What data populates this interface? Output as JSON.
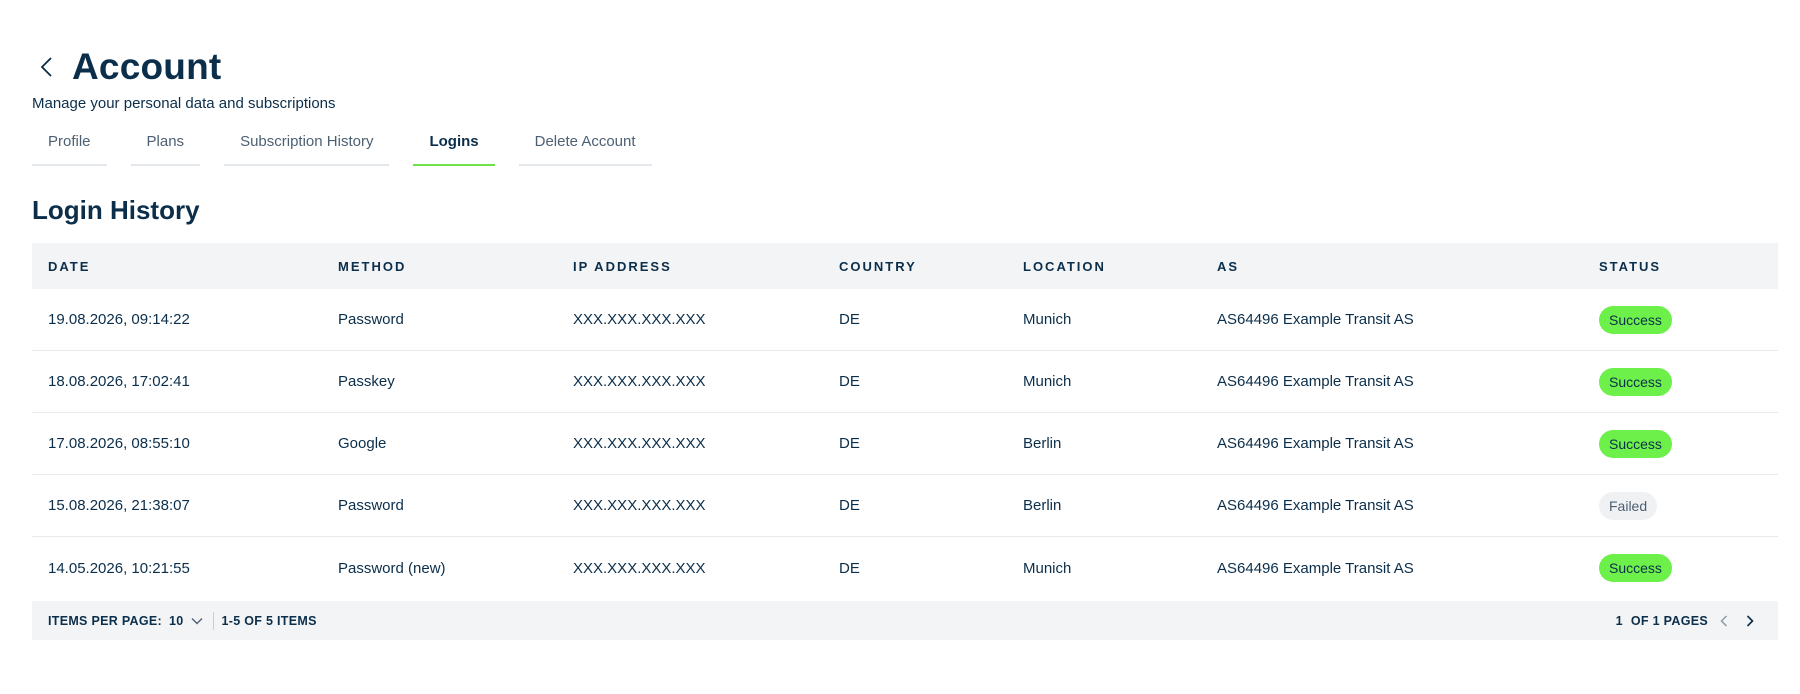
{
  "header": {
    "title": "Account",
    "subtitle": "Manage your personal data and subscriptions",
    "back_icon": "chevron-left-icon"
  },
  "tabs": [
    {
      "label": "Profile",
      "active": false
    },
    {
      "label": "Plans",
      "active": false
    },
    {
      "label": "Subscription History",
      "active": false
    },
    {
      "label": "Logins",
      "active": true
    },
    {
      "label": "Delete Account",
      "active": false
    }
  ],
  "section": {
    "title": "Login History"
  },
  "table": {
    "columns": [
      "DATE",
      "METHOD",
      "IP ADDRESS",
      "COUNTRY",
      "LOCATION",
      "AS",
      "STATUS"
    ],
    "rows": [
      {
        "date": "19.08.2026, 09:14:22",
        "method": "Password",
        "ip": "XXX.XXX.XXX.XXX",
        "country": "DE",
        "location": "Munich",
        "as": "AS64496 Example Transit AS",
        "status": "Success"
      },
      {
        "date": "18.08.2026, 17:02:41",
        "method": "Passkey",
        "ip": "XXX.XXX.XXX.XXX",
        "country": "DE",
        "location": "Munich",
        "as": "AS64496 Example Transit AS",
        "status": "Success"
      },
      {
        "date": "17.08.2026, 08:55:10",
        "method": "Google",
        "ip": "XXX.XXX.XXX.XXX",
        "country": "DE",
        "location": "Berlin",
        "as": "AS64496 Example Transit AS",
        "status": "Success"
      },
      {
        "date": "15.08.2026, 21:38:07",
        "method": "Password",
        "ip": "XXX.XXX.XXX.XXX",
        "country": "DE",
        "location": "Berlin",
        "as": "AS64496 Example Transit AS",
        "status": "Failed"
      },
      {
        "date": "14.05.2026, 10:21:55",
        "method": "Password (new)",
        "ip": "XXX.XXX.XXX.XXX",
        "country": "DE",
        "location": "Munich",
        "as": "AS64496 Example Transit AS",
        "status": "Success"
      }
    ]
  },
  "pagination": {
    "items_per_page_label": "ITEMS PER PAGE:",
    "items_per_page_value": "10",
    "range_text": "1-5 OF 5 ITEMS",
    "current_page": "1",
    "pages_text": "OF 1 PAGES"
  },
  "colors": {
    "primary_text": "#0b2e4a",
    "accent_green": "#6ee24b",
    "success_badge": "#6ef04b",
    "failed_badge": "#eff1f3",
    "table_header_bg": "#f2f4f6"
  }
}
